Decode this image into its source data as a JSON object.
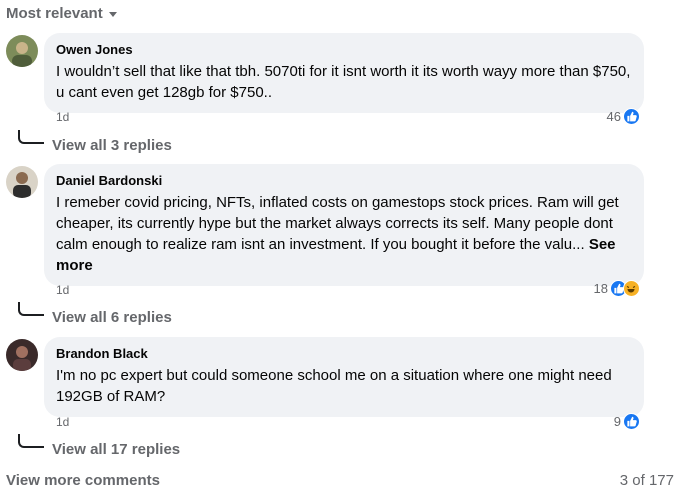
{
  "sort": {
    "label": "Most relevant"
  },
  "comments": [
    {
      "author": "Owen Jones",
      "text": "I wouldn’t sell that like that tbh. 5070ti for it isnt worth it its worth wayy more than $750, u cant even get 128gb for $750..",
      "see_more": "",
      "time": "1d",
      "reaction_count": "46",
      "replies_label": "View all 3 replies"
    },
    {
      "author": "Daniel Bardonski",
      "text": "I remeber covid pricing, NFTs, inflated costs on gamestops stock prices. Ram will get cheaper, its currently hype but the market always corrects its self. Many people dont calm enough to realize ram isnt an investment. If you bought it before the valu...",
      "see_more": "See more",
      "time": "1d",
      "reaction_count": "18",
      "replies_label": "View all 6 replies"
    },
    {
      "author": "Brandon Black",
      "text": "I'm no pc expert but could someone school me on a situation where one might need 192GB of RAM?",
      "see_more": "",
      "time": "1d",
      "reaction_count": "9",
      "replies_label": "View all 17 replies"
    }
  ],
  "footer": {
    "more_label": "View more comments",
    "count_label": "3 of 177"
  },
  "colors": {
    "like": "#1877f2",
    "haha": "#f7b125",
    "bubble": "#f0f2f5",
    "muted": "#65676b"
  }
}
